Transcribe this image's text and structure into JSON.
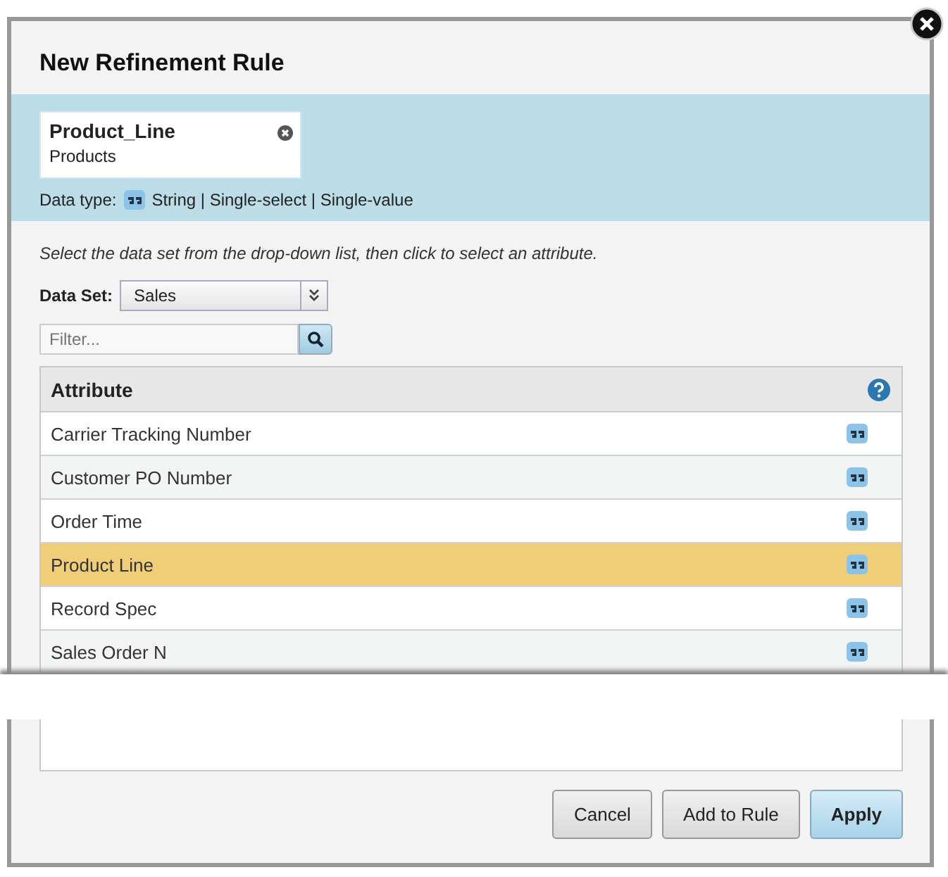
{
  "dialog": {
    "title": "New Refinement Rule"
  },
  "attribute_chip": {
    "name": "Product_Line",
    "subtitle": "Products"
  },
  "data_type": {
    "label": "Data type:",
    "value": "String | Single-select | Single-value"
  },
  "instructions": "Select the data set from the drop-down list, then click to select an attribute.",
  "data_set": {
    "label": "Data Set:",
    "value": "Sales"
  },
  "filter": {
    "placeholder": "Filter..."
  },
  "table": {
    "columns": [
      "Attribute"
    ],
    "rows": [
      {
        "name": "Carrier Tracking Number",
        "selected": false
      },
      {
        "name": "Customer PO Number",
        "selected": false
      },
      {
        "name": "Order Time",
        "selected": false
      },
      {
        "name": "Product Line",
        "selected": true
      },
      {
        "name": "Record Spec",
        "selected": false
      },
      {
        "name": "Sales Order N",
        "selected": false
      }
    ]
  },
  "buttons": [
    {
      "label": "Cancel",
      "kind": "default"
    },
    {
      "label": "Add to Rule",
      "kind": "default"
    },
    {
      "label": "Apply",
      "kind": "primary"
    }
  ]
}
